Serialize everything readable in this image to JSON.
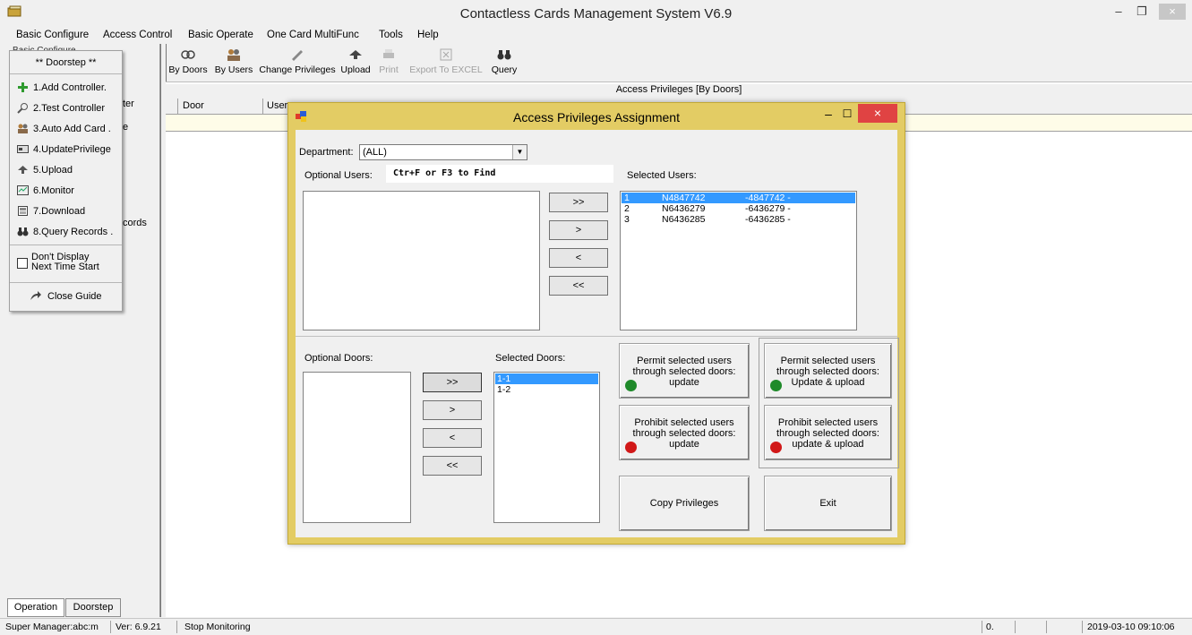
{
  "window": {
    "title": "Contactless Cards Management System  V6.9",
    "min_glyph": "–",
    "restore_glyph": "❐",
    "close_glyph": "×"
  },
  "menu": [
    "Basic Configure",
    "Access Control",
    "Basic Operate",
    "One Card MultiFunc",
    "Tools",
    "Help"
  ],
  "left_panel": {
    "tree_top": "Basic Configure",
    "guide_title": "** Doorstep **",
    "guide_items": [
      "1.Add Controller.",
      "2.Test Controller",
      "3.Auto Add Card .",
      "4.UpdatePrivilege",
      "5.Upload",
      "6.Monitor",
      "7.Download",
      "8.Query Records ."
    ],
    "dont_display": "Don't Display\nNext Time Start",
    "close_guide": "Close Guide",
    "bg_fragments": [
      "ter",
      "e",
      "cords"
    ],
    "tabs": [
      "Operation",
      "Doorstep"
    ]
  },
  "toolbar": {
    "buttons": [
      "By Doors",
      "By Users",
      "Change Privileges",
      "Upload",
      "Print",
      "Export To EXCEL",
      "Query"
    ]
  },
  "grid": {
    "caption": "Access Privileges [By Doors]",
    "columns": [
      "Door",
      "User"
    ]
  },
  "dialog": {
    "title": "Access Privileges Assignment",
    "department_label": "Department:",
    "department_value": "(ALL)",
    "optional_users_label": "Optional Users:",
    "find_hint": "Ctr+F  or F3 to Find",
    "selected_users_label": "Selected Users:",
    "selected_users": [
      {
        "no": "1",
        "card": "N4847742",
        "name": "-4847742 -"
      },
      {
        "no": "2",
        "card": "N6436279",
        "name": "-6436279 -"
      },
      {
        "no": "3",
        "card": "N6436285",
        "name": "-6436285 -"
      }
    ],
    "move_buttons": [
      ">>",
      ">",
      "<",
      "<<"
    ],
    "optional_doors_label": "Optional Doors:",
    "selected_doors_label": "Selected Doors:",
    "selected_doors": [
      "1-1",
      "1-2"
    ],
    "permit_update": "Permit selected users through selected doors: update",
    "permit_upload": "Permit selected users through selected doors: Update & upload",
    "prohibit_update": "Prohibit selected users through selected doors: update",
    "prohibit_upload": "Prohibit selected users through selected doors: update & upload",
    "copy_privileges": "Copy Privileges",
    "exit": "Exit"
  },
  "status": {
    "user": "Super Manager:abc:m",
    "version": "Ver: 6.9.21",
    "monitoring": "Stop Monitoring",
    "counter": "0.",
    "datetime": "2019-03-10 09:10:06"
  },
  "colors": {
    "dialog_frame": "#e3cc64",
    "close_button": "#e04343",
    "selection": "#3399ff",
    "grid_row": "#fefce8"
  }
}
